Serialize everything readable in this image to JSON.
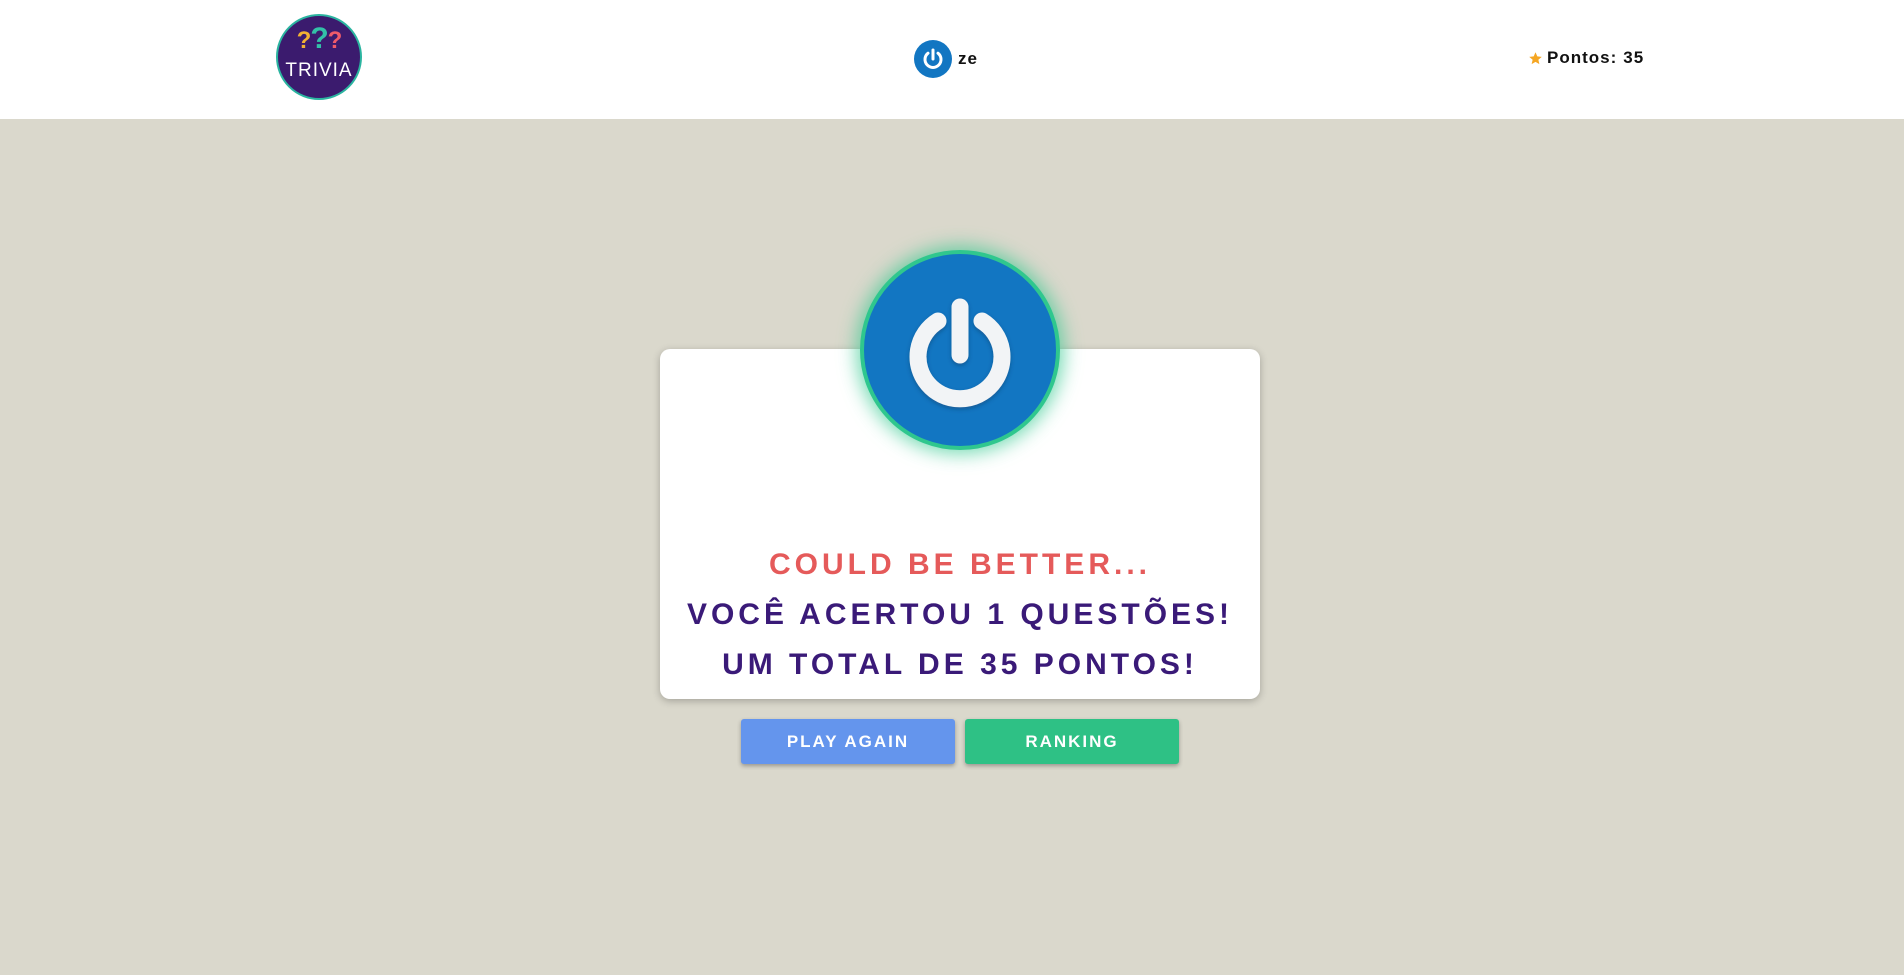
{
  "header": {
    "logo_text": "TRIVIA",
    "logo_qmarks": [
      "?",
      "?",
      "?"
    ],
    "user_name": "ze",
    "score_label": "Pontos:",
    "score_value": "35",
    "avatar_icon": "power-icon"
  },
  "feedback": {
    "title": "COULD BE BETTER...",
    "assertions_prefix": "VOCÊ ACERTOU",
    "assertions_count": "1",
    "assertions_suffix": "QUESTÕES!",
    "total_prefix": "UM TOTAL DE",
    "total_score": "35",
    "total_suffix": "PONTOS!"
  },
  "buttons": {
    "play_again": "PLAY AGAIN",
    "ranking": "RANKING"
  },
  "colors": {
    "background": "#dad8cc",
    "title_red": "#e55a5a",
    "text_purple": "#3a1a78",
    "play_button": "#6495ed",
    "ranking_button": "#2ec185",
    "avatar_blue": "#1276c2",
    "avatar_ring": "#2fc78e",
    "star": "#f5a623"
  }
}
